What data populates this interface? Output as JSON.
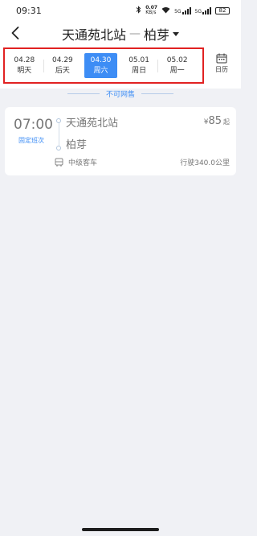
{
  "status_bar": {
    "time": "09:31",
    "speed_value": "0.07",
    "speed_unit": "KB/s",
    "net_label_1": "5G",
    "net_label_2": "5G",
    "battery": "82"
  },
  "header": {
    "origin": "天通苑北站",
    "separator": "—",
    "destination": "柏芽"
  },
  "dates": [
    {
      "date": "04.28",
      "day": "明天"
    },
    {
      "date": "04.29",
      "day": "后天"
    },
    {
      "date": "04.30",
      "day": "周六"
    },
    {
      "date": "05.01",
      "day": "周日"
    },
    {
      "date": "05.02",
      "day": "周一"
    }
  ],
  "calendar_label": "日历",
  "notice": "不可网售",
  "trip": {
    "time": "07:00",
    "tag": "固定班次",
    "from": "天通苑北站",
    "to": "柏芽",
    "currency": "¥",
    "price": "85",
    "price_suffix": "起",
    "bus_type": "中级客车",
    "distance": "行驶340.0公里"
  },
  "colors": {
    "accent": "#3d8df5",
    "highlight_box": "#e12222",
    "background": "#f0f1f5"
  }
}
